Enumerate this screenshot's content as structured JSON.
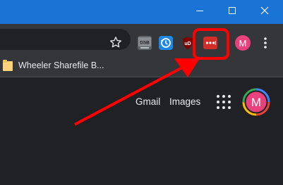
{
  "window": {
    "titlebar_color": "#1a74d6",
    "controls": [
      "minimize-icon",
      "maximize-icon",
      "close-icon"
    ]
  },
  "toolbar": {
    "extensions": [
      {
        "name": "dsb-extension",
        "label": "DSB"
      },
      {
        "name": "history-extension"
      },
      {
        "name": "ublock-extension",
        "label": "uD"
      },
      {
        "name": "lastpass-extension",
        "label": "•••"
      }
    ],
    "profile_initial": "M",
    "profile_color": "#e8417c"
  },
  "bookmarks": {
    "items": [
      {
        "label": "Wheeler Sharefile B..."
      }
    ]
  },
  "google": {
    "gmail": "Gmail",
    "images": "Images",
    "avatar_initial": "M"
  },
  "annotation": {
    "highlight_color": "#ff0000"
  }
}
